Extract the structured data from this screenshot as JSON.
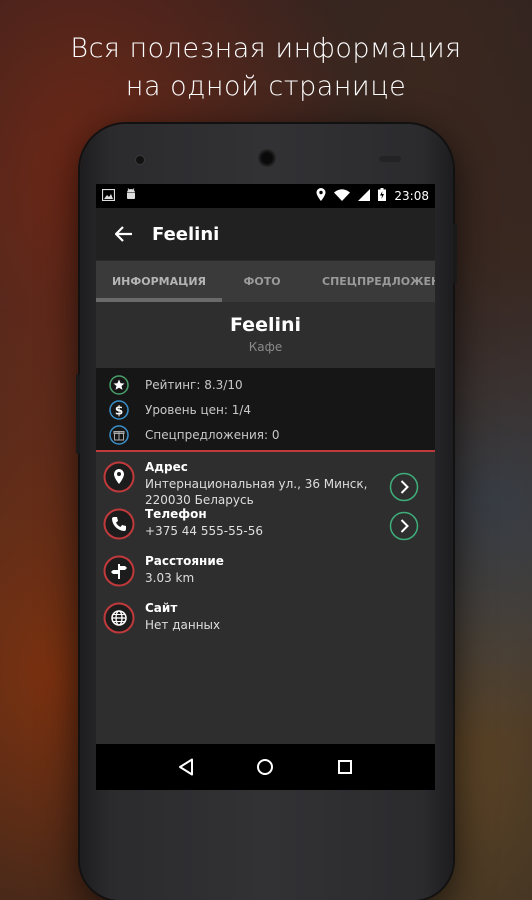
{
  "promo": {
    "line1": "Вся полезная информация",
    "line2": "на одной странице"
  },
  "status_bar": {
    "time": "23:08",
    "icons": [
      "image-icon",
      "android-icon",
      "location-icon",
      "wifi-icon",
      "signal-icon",
      "battery-charging-icon"
    ]
  },
  "toolbar": {
    "title": "Feelini",
    "back_icon": "arrow-back-icon"
  },
  "tabs": [
    {
      "label": "ИНФОРМАЦИЯ",
      "selected": true
    },
    {
      "label": "ФОТО",
      "selected": false
    },
    {
      "label": "СПЕЦПРЕДЛОЖЕНИЯ",
      "selected": false
    }
  ],
  "place": {
    "name": "Feelini",
    "type": "Кафе"
  },
  "info": {
    "rating": "Рейтинг: 8.3/10",
    "price": "Уровень цен: 1/4",
    "offers": "Спецпредложения: 0"
  },
  "details": {
    "address": {
      "label": "Адрес",
      "line1": "Интернациональная ул., 36 Минск,",
      "line2": "220030 Беларусь"
    },
    "phone": {
      "label": "Телефон",
      "value": "+375 44 555-55-56"
    },
    "distance": {
      "label": "Расстояние",
      "value": "3.03 km"
    },
    "site": {
      "label": "Сайт",
      "value": "Нет данных"
    }
  },
  "colors": {
    "accent_red": "#c0393b",
    "accent_green": "#3fae7a",
    "accent_blue": "#3b8fc8",
    "star_green": "#4a9e6a"
  }
}
